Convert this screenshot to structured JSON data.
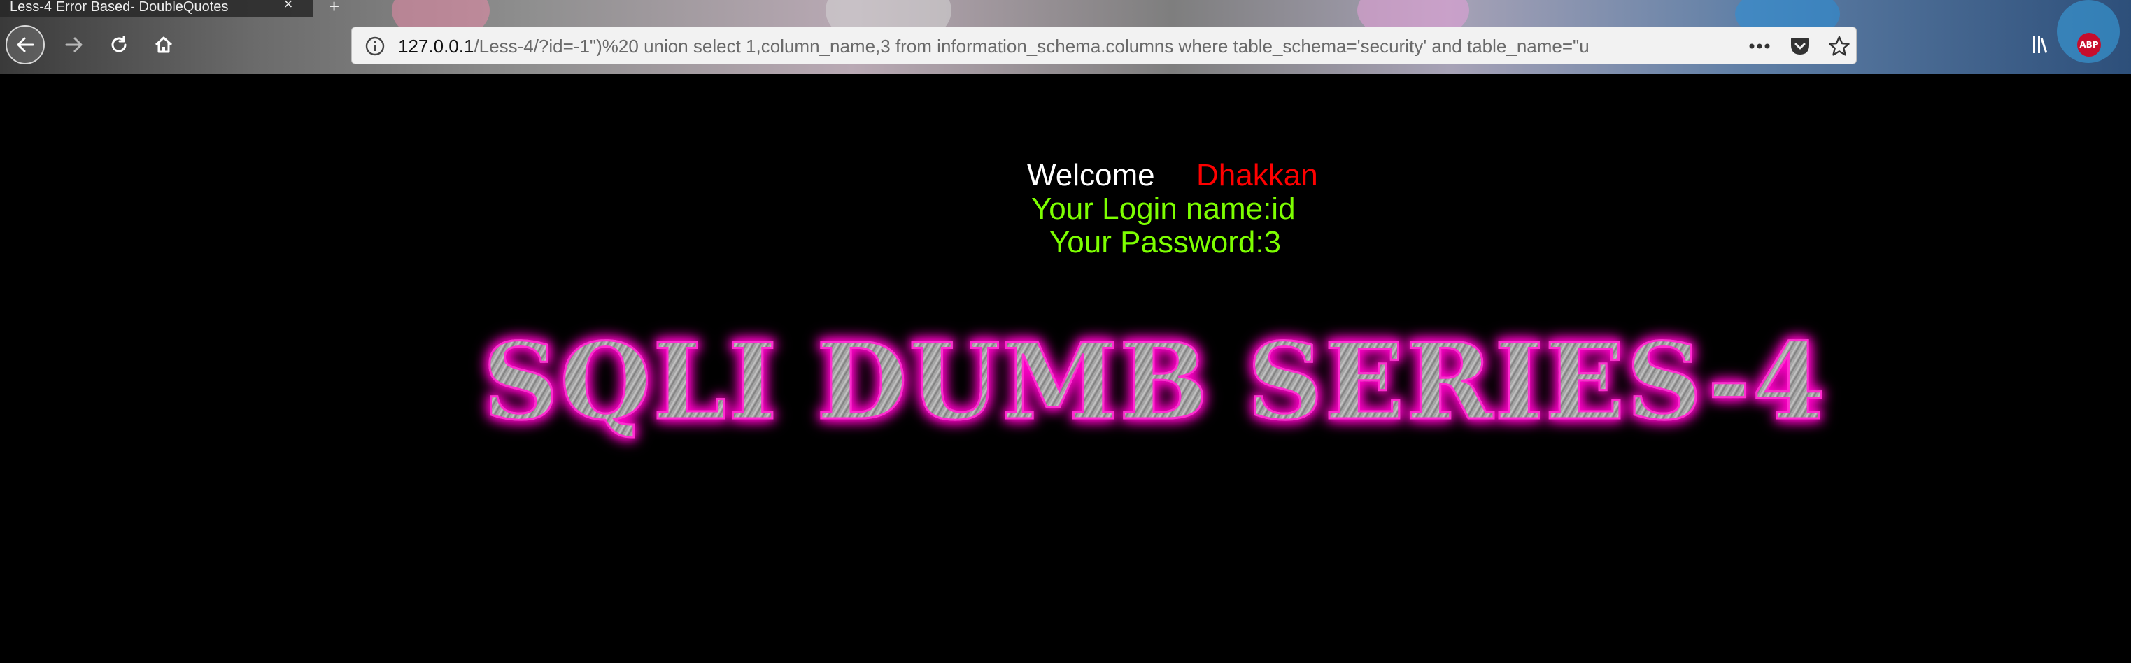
{
  "browser": {
    "tab_title": "Less-4 Error Based- DoubleQuotes",
    "tab_close": "×",
    "new_tab": "+",
    "url": {
      "host": "127.0.0.1",
      "path": "/Less-4/?id=-1\")%20 union select 1,column_name,3 from information_schema.columns where table_schema='security' and table_name=\"u"
    },
    "icons": {
      "back": "back-arrow-icon",
      "forward": "forward-arrow-icon",
      "reload": "reload-icon",
      "home": "home-icon",
      "info": "info-icon",
      "page_actions": "more-actions-icon",
      "pocket": "pocket-icon",
      "bookmark": "bookmark-star-icon",
      "library": "library-icon",
      "adblock": "adblock-plus-icon"
    },
    "abp_label": "ABP"
  },
  "page": {
    "welcome_label": "Welcome",
    "user_name": "Dhakkan",
    "login_line": "Your Login name:id",
    "password_line": "Your Password:3",
    "banner_title": "SQLI DUMB SERIES-4"
  },
  "colors": {
    "background": "#000000",
    "welcome": "#ffffff",
    "user_name": "#ff0000",
    "credentials": "#7dff00",
    "banner_glow": "#ff00c8"
  }
}
